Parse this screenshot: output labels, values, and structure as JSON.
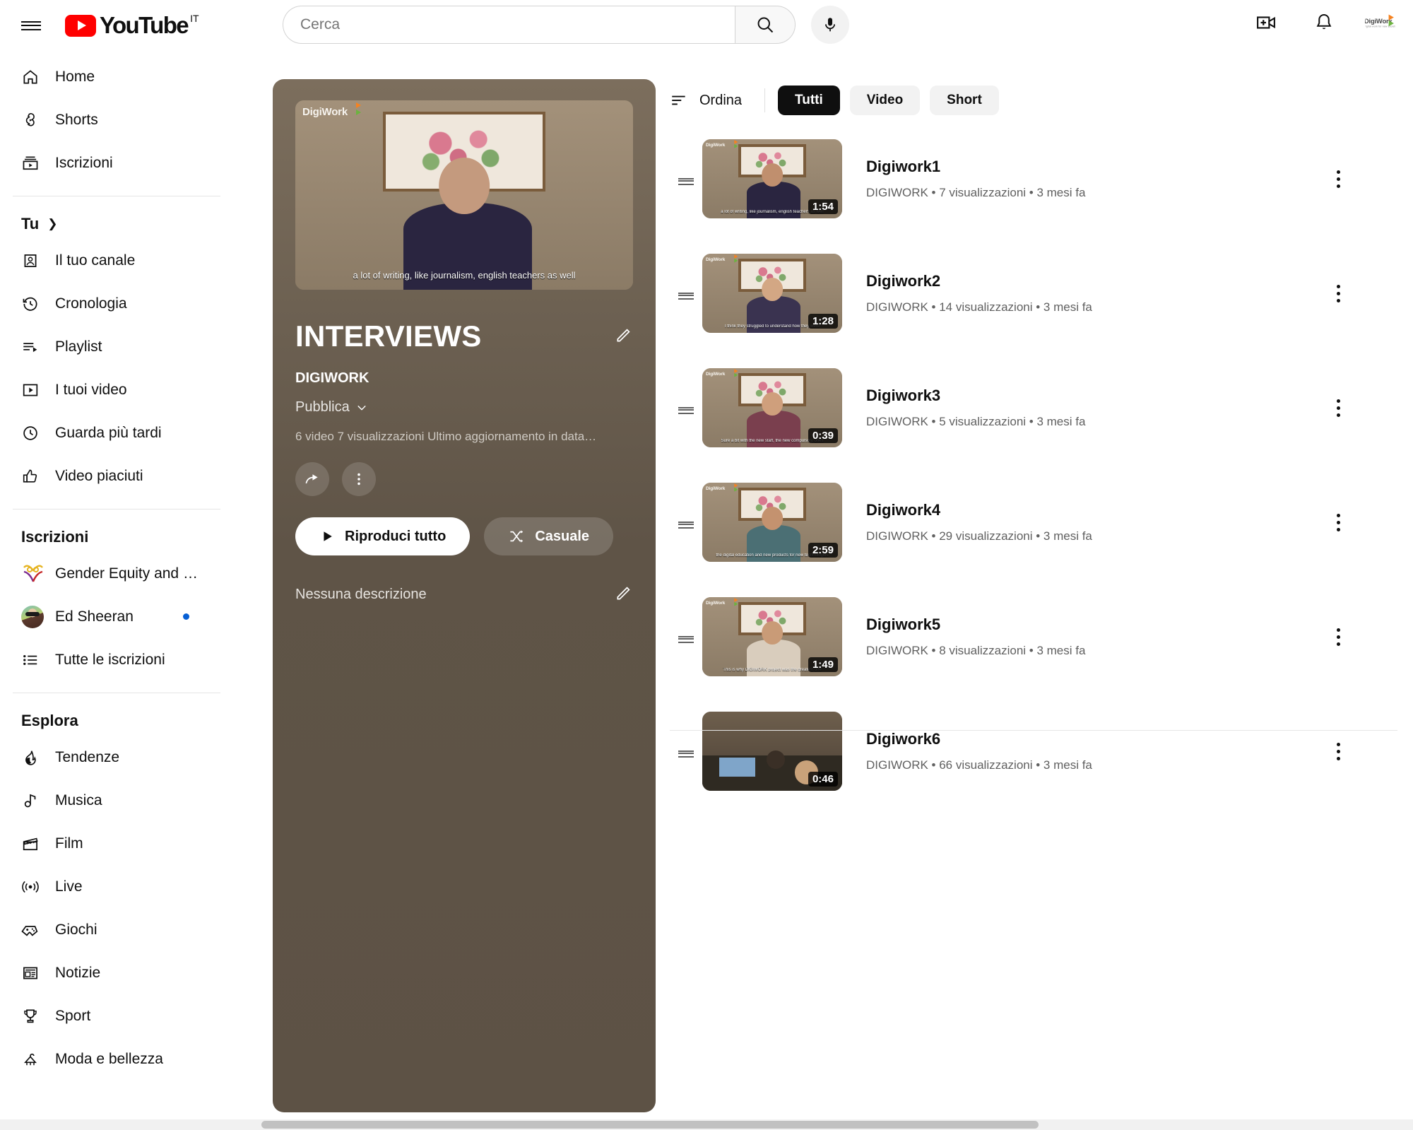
{
  "header": {
    "menu_icon": "hamburger-menu-icon",
    "logo_text": "YouTube",
    "logo_country": "IT",
    "search": {
      "value": "",
      "placeholder": "Cerca",
      "search_icon": "search-icon"
    },
    "mic_icon": "microphone-icon",
    "create_icon": "create-video-icon",
    "notifications_icon": "bell-icon",
    "avatar_name": "DigiWork"
  },
  "sidebar": {
    "primary": [
      {
        "label": "Home",
        "icon": "home-icon"
      },
      {
        "label": "Shorts",
        "icon": "shorts-icon"
      },
      {
        "label": "Iscrizioni",
        "icon": "subscriptions-icon"
      }
    ],
    "you_section": {
      "label": "Tu",
      "chevron": "chevron-right-icon"
    },
    "you_items": [
      {
        "label": "Il tuo canale",
        "icon": "your-channel-icon"
      },
      {
        "label": "Cronologia",
        "icon": "history-icon"
      },
      {
        "label": "Playlist",
        "icon": "playlist-icon"
      },
      {
        "label": "I tuoi video",
        "icon": "your-videos-icon"
      },
      {
        "label": "Guarda più tardi",
        "icon": "watch-later-icon"
      },
      {
        "label": "Video piaciuti",
        "icon": "thumbs-up-icon"
      }
    ],
    "subs_section": {
      "label": "Iscrizioni"
    },
    "subs_items": [
      {
        "label": "Gender Equity and …",
        "icon": "channel-avatar",
        "unread": false
      },
      {
        "label": "Ed Sheeran",
        "icon": "channel-avatar",
        "unread": true
      },
      {
        "label": "Tutte le iscrizioni",
        "icon": "all-subscriptions-icon",
        "unread": false
      }
    ],
    "explore_section": {
      "label": "Esplora"
    },
    "explore_items": [
      {
        "label": "Tendenze",
        "icon": "trending-icon"
      },
      {
        "label": "Musica",
        "icon": "music-note-icon"
      },
      {
        "label": "Film",
        "icon": "film-clapper-icon"
      },
      {
        "label": "Live",
        "icon": "live-broadcast-icon"
      },
      {
        "label": "Giochi",
        "icon": "gaming-controller-icon"
      },
      {
        "label": "Notizie",
        "icon": "news-icon"
      },
      {
        "label": "Sport",
        "icon": "trophy-icon"
      },
      {
        "label": "Moda e bellezza",
        "icon": "fashion-hanger-icon"
      }
    ]
  },
  "playlist": {
    "title": "INTERVIEWS",
    "owner": "DIGIWORK",
    "privacy": "Pubblica",
    "privacy_chevron": "chevron-down-icon",
    "stats": "6 video  7 visualizzazioni  Ultimo aggiornamento in data…",
    "video_count": "6 video",
    "views": "7 visualizzazioni",
    "updated": "Ultimo aggiornamento in data…",
    "share_icon": "share-icon",
    "more_icon": "more-vertical-icon",
    "edit_title_icon": "pencil-edit-icon",
    "edit_desc_icon": "pencil-edit-icon",
    "play_all_label": "Riproduci tutto",
    "play_icon": "play-icon",
    "shuffle_label": "Casuale",
    "shuffle_icon": "shuffle-icon",
    "description": "Nessuna descrizione",
    "thumb_caption": "a lot of writing, like journalism, english teachers as well",
    "accent_bg": "#5f5447"
  },
  "toolbar": {
    "sort_label": "Ordina",
    "sort_icon": "sort-icon",
    "chips": [
      {
        "label": "Tutti",
        "active": true
      },
      {
        "label": "Video",
        "active": false
      },
      {
        "label": "Short",
        "active": false
      }
    ]
  },
  "videos": [
    {
      "title": "Digiwork1",
      "channel": "DIGIWORK",
      "views": "7 visualizzazioni",
      "age": "3 mesi fa",
      "meta": "DIGIWORK • 7 visualizzazioni • 3 mesi fa",
      "duration": "1:54",
      "caption": "a lot of writing, like journalism, english teachers as well",
      "art": "portrait-male"
    },
    {
      "title": "Digiwork2",
      "channel": "DIGIWORK",
      "views": "14 visualizzazioni",
      "age": "3 mesi fa",
      "meta": "DIGIWORK • 14 visualizzazioni • 3 mesi fa",
      "duration": "1:28",
      "caption": "I think they struggled to understand how they were",
      "art": "portrait-female"
    },
    {
      "title": "Digiwork3",
      "channel": "DIGIWORK",
      "views": "5 visualizzazioni",
      "age": "3 mesi fa",
      "meta": "DIGIWORK • 5 visualizzazioni • 3 mesi fa",
      "duration": "0:39",
      "caption": "Sure a bit with the new staff, the new compulsory ones",
      "art": "portrait-female"
    },
    {
      "title": "Digiwork4",
      "channel": "DIGIWORK",
      "views": "29 visualizzazioni",
      "age": "3 mesi fa",
      "meta": "DIGIWORK • 29 visualizzazioni • 3 mesi fa",
      "duration": "2:59",
      "caption": "the digital education and new products for new technologies",
      "art": "portrait-female"
    },
    {
      "title": "Digiwork5",
      "channel": "DIGIWORK",
      "views": "8 visualizzazioni",
      "age": "3 mesi fa",
      "meta": "DIGIWORK • 8 visualizzazioni • 3 mesi fa",
      "duration": "1:49",
      "caption": "This is why DIGIWORK project was the greatest one",
      "art": "portrait-female"
    },
    {
      "title": "Digiwork6",
      "channel": "DIGIWORK",
      "views": "66 visualizzazioni",
      "age": "3 mesi fa",
      "meta": "DIGIWORK • 66 visualizzazioni • 3 mesi fa",
      "duration": "0:46",
      "caption": "",
      "art": "office-meeting"
    }
  ],
  "row_grip_icon": "drag-handle-icon",
  "row_menu_icon": "more-vertical-icon"
}
